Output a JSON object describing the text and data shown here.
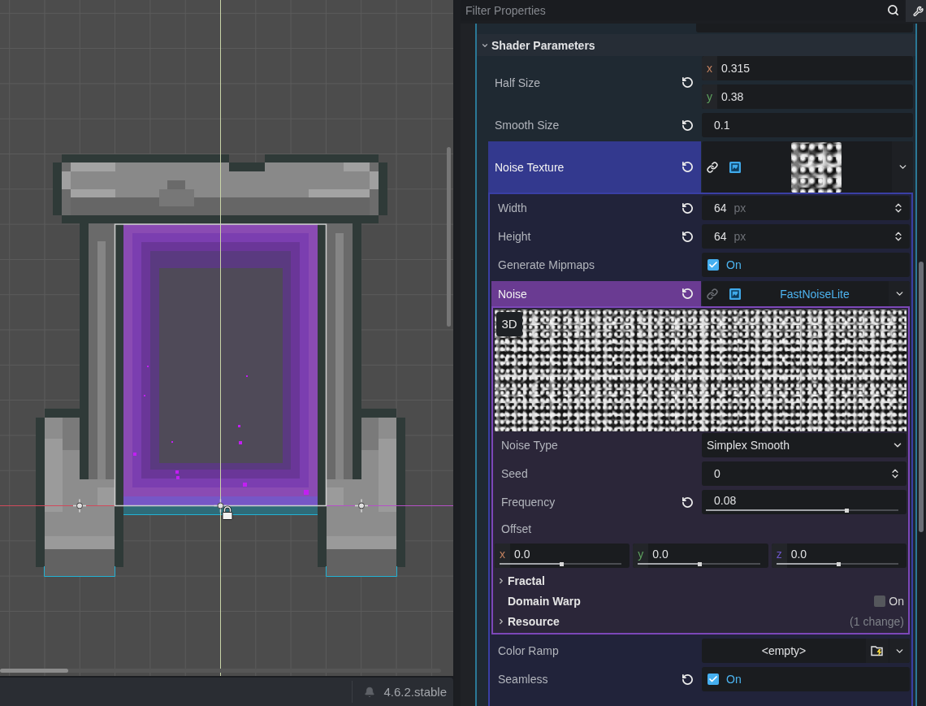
{
  "inspector": {
    "filter": {
      "placeholder": "Filter Properties"
    },
    "section": {
      "title": "Shader Parameters",
      "expanded": true,
      "properties": [
        {
          "kind": "vector",
          "label": "Half Size",
          "revertable": true,
          "components": [
            {
              "axis": "x",
              "value": "0.315",
              "color": "#c4825f"
            },
            {
              "axis": "y",
              "value": "0.38",
              "color": "#5ea25e"
            }
          ]
        },
        {
          "kind": "number",
          "label": "Smooth Size",
          "revertable": true,
          "value": "0.1"
        },
        {
          "kind": "resource",
          "label": "Noise Texture",
          "revertable": true,
          "linked": true,
          "expanded": true,
          "properties": [
            {
              "kind": "spin",
              "label": "Width",
              "revertable": true,
              "value": "64",
              "unit": "px"
            },
            {
              "kind": "spin",
              "label": "Height",
              "revertable": true,
              "value": "64",
              "unit": "px"
            },
            {
              "kind": "check",
              "label": "Generate Mipmaps",
              "revertable": false,
              "checked": true,
              "value": "On"
            },
            {
              "kind": "resource",
              "label": "Noise",
              "revertable": true,
              "linked": false,
              "expanded": true,
              "value": "FastNoiseLite",
              "preview": {
                "badge": "3D"
              },
              "properties": [
                {
                  "kind": "dropdown",
                  "label": "Noise Type",
                  "revertable": false,
                  "value": "Simplex Smooth"
                },
                {
                  "kind": "spin",
                  "label": "Seed",
                  "revertable": false,
                  "value": "0"
                },
                {
                  "kind": "slider",
                  "label": "Frequency",
                  "revertable": true,
                  "value": "0.08",
                  "level": 0.73
                },
                {
                  "kind": "vector_slider",
                  "label": "Offset",
                  "revertable": false,
                  "components": [
                    {
                      "axis": "x",
                      "value": "0.0",
                      "level": 0.51,
                      "color": "#c4825f"
                    },
                    {
                      "axis": "y",
                      "value": "0.0",
                      "level": 0.51,
                      "color": "#5ea25e"
                    },
                    {
                      "axis": "z",
                      "value": "0.0",
                      "level": 0.51,
                      "color": "#6c55c8"
                    }
                  ]
                },
                {
                  "kind": "group",
                  "label": "Fractal",
                  "expanded": false
                },
                {
                  "kind": "group_toggle",
                  "label": "Domain Warp",
                  "checked": false,
                  "value": "On"
                },
                {
                  "kind": "group",
                  "label": "Resource",
                  "expanded": false,
                  "note": "(1 change)"
                }
              ]
            },
            {
              "kind": "resource_empty",
              "label": "Color Ramp",
              "revertable": false,
              "value": "<empty>"
            },
            {
              "kind": "check",
              "label": "Seamless",
              "revertable": true,
              "checked": true,
              "value": "On"
            }
          ]
        }
      ]
    }
  },
  "status_bar": {
    "version": "4.6.2.stable"
  }
}
